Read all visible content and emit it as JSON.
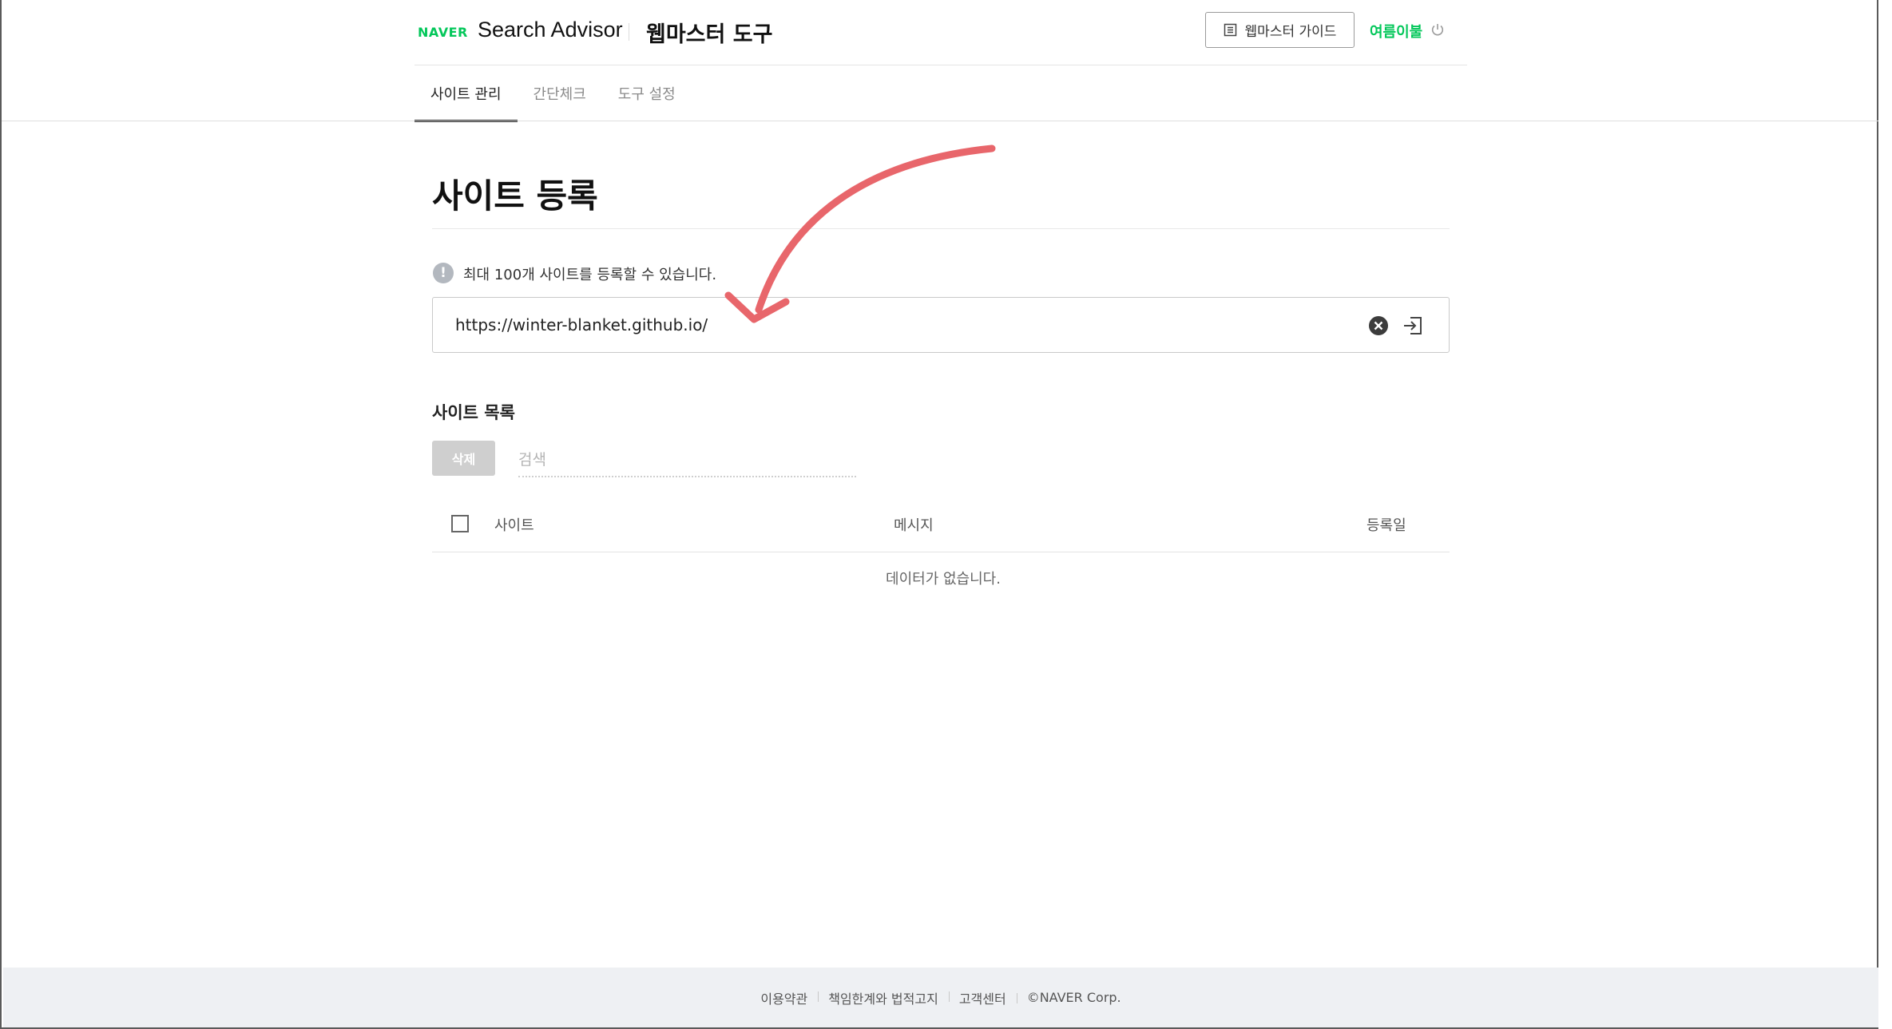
{
  "header": {
    "logo": "NAVER",
    "brand": "Search Advisor",
    "tool_title": "웹마스터 도구",
    "guide_label": "웹마스터 가이드",
    "user_name": "여름이불"
  },
  "tabs": [
    {
      "label": "사이트 관리",
      "active": true
    },
    {
      "label": "간단체크",
      "active": false
    },
    {
      "label": "도구 설정",
      "active": false
    }
  ],
  "register": {
    "title": "사이트 등록",
    "notice": "최대 100개 사이트를 등록할 수 있습니다.",
    "url_value": "https://winter-blanket.github.io/"
  },
  "site_list": {
    "title": "사이트 목록",
    "delete_label": "삭제",
    "search_placeholder": "검색",
    "columns": {
      "site": "사이트",
      "message": "메시지",
      "date": "등록일"
    },
    "empty_text": "데이터가 없습니다."
  },
  "footer": {
    "items": [
      "이용약관",
      "책임한계와 법적고지",
      "고객센터",
      "©NAVER Corp."
    ]
  },
  "colors": {
    "naver_green": "#03c75a",
    "annotation_arrow": "#e8666b"
  },
  "icons": [
    "guide-book-icon",
    "power-icon",
    "info-icon",
    "clear-icon",
    "submit-icon",
    "checkbox-icon"
  ]
}
